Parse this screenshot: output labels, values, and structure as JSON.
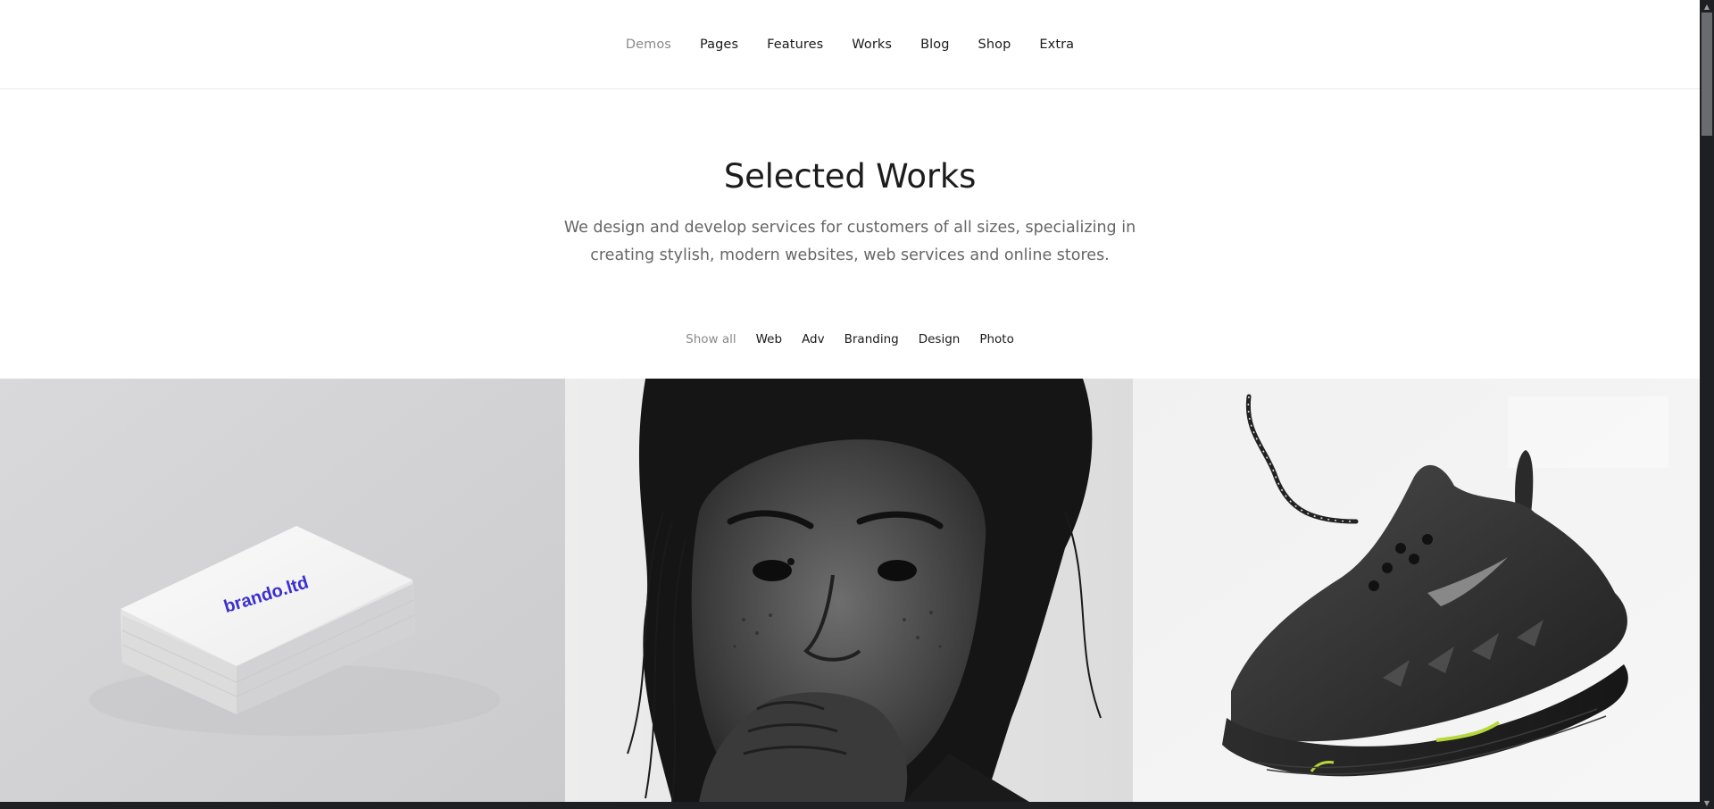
{
  "nav": {
    "items": [
      {
        "label": "Demos",
        "active": true
      },
      {
        "label": "Pages",
        "active": false
      },
      {
        "label": "Features",
        "active": false
      },
      {
        "label": "Works",
        "active": false
      },
      {
        "label": "Blog",
        "active": false
      },
      {
        "label": "Shop",
        "active": false
      },
      {
        "label": "Extra",
        "active": false
      }
    ]
  },
  "hero": {
    "title": "Selected Works",
    "subtitle": "We design and develop services for customers of all sizes, specializing in creating stylish, modern websites, web services and online stores."
  },
  "filters": {
    "items": [
      {
        "label": "Show all",
        "active": true
      },
      {
        "label": "Web",
        "active": false
      },
      {
        "label": "Adv",
        "active": false
      },
      {
        "label": "Branding",
        "active": false
      },
      {
        "label": "Design",
        "active": false
      },
      {
        "label": "Photo",
        "active": false
      }
    ]
  },
  "gallery": {
    "items": [
      {
        "image": "business-cards-photo",
        "card_text": "brando.ltd"
      },
      {
        "image": "portrait-photo"
      },
      {
        "image": "sneaker-photo"
      }
    ]
  },
  "colors": {
    "text": "#1a1a1a",
    "muted": "#8a8a8a",
    "brand_blue": "#3b2fd0"
  }
}
